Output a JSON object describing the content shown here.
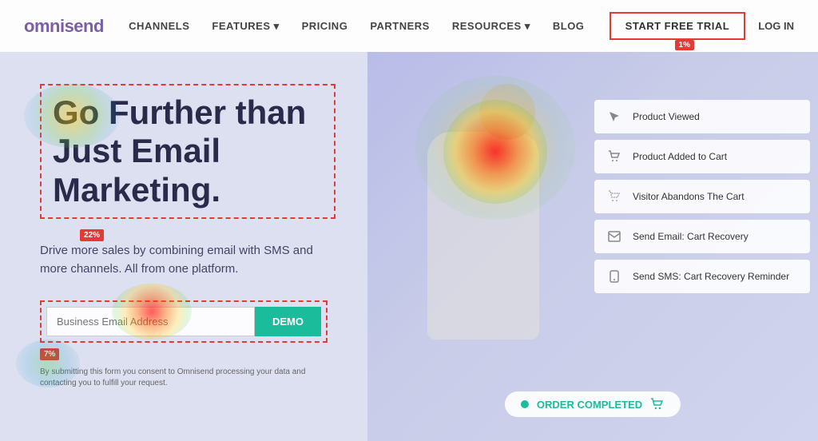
{
  "logo": {
    "prefix": "omni",
    "highlight": "send"
  },
  "navbar": {
    "links": [
      {
        "label": "CHANNELS",
        "active": true
      },
      {
        "label": "FEATURES ▾",
        "active": false
      },
      {
        "label": "PRICING",
        "active": false
      },
      {
        "label": "PARTNERS",
        "active": false
      },
      {
        "label": "RESOURCES ▾",
        "active": false
      },
      {
        "label": "BLOG",
        "active": false
      }
    ],
    "trial_button": "START FREE TRIAL",
    "login_button": "LOG IN"
  },
  "heat_badge_trial": "1%",
  "hero": {
    "headline": "Go Further than Just Email Marketing.",
    "subheadline": "Drive more sales by combining email with SMS and more channels. All from one platform.",
    "email_placeholder": "Business Email Address",
    "demo_button": "DEMO",
    "consent_text": "By submitting this form you consent to Omnisend processing your data and contacting you to fulfill your request.",
    "headline_badge": "22%",
    "form_badge": "7%"
  },
  "workflow": {
    "cards": [
      {
        "icon": "cursor",
        "label": "Product Viewed"
      },
      {
        "icon": "cart-add",
        "label": "Product Added to Cart"
      },
      {
        "icon": "cart-abandon",
        "label": "Visitor Abandons The Cart"
      },
      {
        "icon": "email",
        "label": "Send Email: Cart Recovery"
      },
      {
        "icon": "sms",
        "label": "Send SMS: Cart Recovery Reminder"
      }
    ],
    "order_completed": "ORDER COMPLETED"
  }
}
